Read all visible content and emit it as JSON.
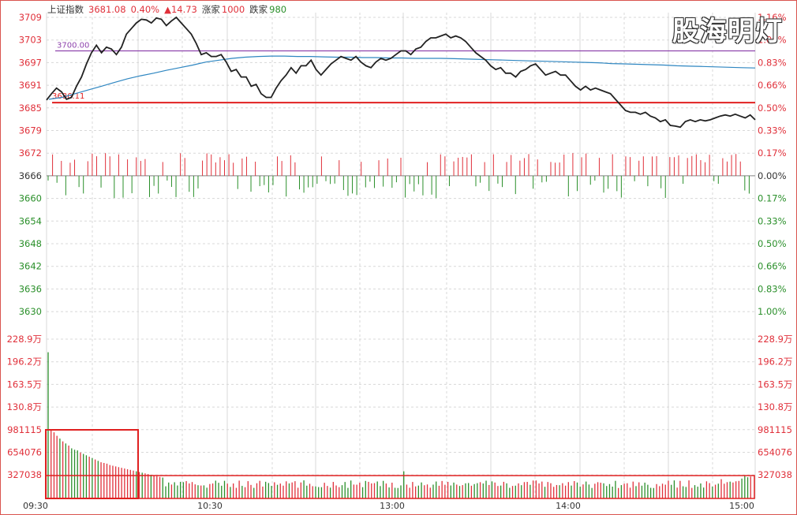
{
  "header": {
    "name": "上证指数",
    "price": "3681.08",
    "pct": "0.40%",
    "change": "▲14.73",
    "up_label": "涨家",
    "up_count": "1000",
    "down_label": "跌家",
    "down_count": "980"
  },
  "watermark": "股海明灯",
  "colors": {
    "up": "#e0303a",
    "down": "#2a8f2a",
    "price_line": "#222222",
    "avg_line": "#2e86c1",
    "ref_line": "#8e44ad",
    "base_line": "#e02020",
    "grid": "#d8d8d8",
    "box": "#e02020"
  },
  "chart_data": [
    {
      "type": "line",
      "title": "",
      "y_left_ticks": [
        "3709",
        "3703",
        "3697",
        "3691",
        "3685",
        "3679",
        "3672",
        "3666",
        "3660",
        "3654",
        "3648",
        "3642",
        "3636",
        "3630"
      ],
      "y_right_ticks": [
        "1.16%",
        "1.00%",
        "0.83%",
        "0.66%",
        "0.50%",
        "0.33%",
        "0.17%",
        "0.00%",
        "0.17%",
        "0.33%",
        "0.50%",
        "0.66%",
        "0.83%",
        "1.00%"
      ],
      "ylim": [
        3630,
        3709
      ],
      "prev_close": 3666,
      "x_ticks": [
        "09:30",
        "10:30",
        "13:00",
        "14:00",
        "15:00"
      ],
      "annotations": [
        {
          "label": "3700.00",
          "y": 3700
        },
        {
          "label": "3686.11",
          "y": 3686.11
        }
      ],
      "price_series": [
        3686.8,
        3688.5,
        3690.0,
        3689.0,
        3687.0,
        3687.5,
        3690.5,
        3693.0,
        3696.5,
        3699.5,
        3701.5,
        3699.5,
        3701.0,
        3700.5,
        3699.0,
        3701.0,
        3704.5,
        3706.0,
        3707.5,
        3708.5,
        3708.3,
        3707.5,
        3708.8,
        3708.5,
        3706.8,
        3708.0,
        3709.0,
        3707.5,
        3706.0,
        3704.5,
        3702.0,
        3699.0,
        3699.5,
        3698.5,
        3698.5,
        3699.0,
        3697.0,
        3694.5,
        3695.0,
        3693.0,
        3693.0,
        3690.5,
        3691.0,
        3688.5,
        3687.5,
        3687.5,
        3690.0,
        3692.0,
        3693.5,
        3695.5,
        3694.0,
        3696.0,
        3696.0,
        3697.5,
        3695.0,
        3693.5,
        3695.0,
        3696.5,
        3697.5,
        3698.5,
        3698.0,
        3697.5,
        3698.5,
        3697.0,
        3696.0,
        3695.5,
        3697.0,
        3698.0,
        3697.5,
        3698.0,
        3699.0,
        3700.0,
        3700.0,
        3699.0,
        3700.5,
        3701.0,
        3702.5,
        3703.5,
        3703.5,
        3704.0,
        3704.5,
        3703.5,
        3704.0,
        3703.5,
        3702.5,
        3701.0,
        3699.5,
        3698.5,
        3697.5,
        3696.0,
        3695.0,
        3695.5,
        3694.0,
        3694.0,
        3693.0,
        3694.5,
        3695.0,
        3696.0,
        3696.5,
        3695.0,
        3693.5,
        3694.0,
        3694.5,
        3693.5,
        3693.5,
        3692.0,
        3690.5,
        3689.5,
        3690.5,
        3689.5,
        3690.0,
        3689.5,
        3689.0,
        3688.5,
        3687.0,
        3685.5,
        3684.0,
        3683.5,
        3683.5,
        3683.0,
        3683.5,
        3682.5,
        3682.0,
        3681.0,
        3681.5,
        3680.0,
        3679.8,
        3679.5,
        3681.0,
        3681.5,
        3681.0,
        3681.5,
        3681.2,
        3681.5,
        3682.0,
        3682.5,
        3682.8,
        3682.5,
        3683.0,
        3682.5,
        3682.0,
        3682.8,
        3681.5
      ],
      "avg_series": [
        3687.0,
        3687.5,
        3688.5,
        3689.5,
        3690.5,
        3691.5,
        3692.5,
        3693.3,
        3694.0,
        3694.8,
        3695.5,
        3696.2,
        3697.0,
        3697.5,
        3698.0,
        3698.3,
        3698.5,
        3698.6,
        3698.6,
        3698.5,
        3698.5,
        3698.4,
        3698.3,
        3698.3,
        3698.2,
        3698.2,
        3698.1,
        3698.1,
        3698.0,
        3698.0,
        3698.0,
        3697.9,
        3697.8,
        3697.7,
        3697.6,
        3697.5,
        3697.4,
        3697.3,
        3697.2,
        3697.1,
        3697.0,
        3696.9,
        3696.8,
        3696.6,
        3696.5,
        3696.4,
        3696.3,
        3696.2,
        3696.0,
        3695.9,
        3695.8,
        3695.7,
        3695.6,
        3695.5,
        3695.4
      ]
    },
    {
      "type": "bar",
      "title": "",
      "y_left_ticks": [
        "228.9万",
        "196.2万",
        "163.5万",
        "130.8万",
        "981115",
        "654076",
        "327038"
      ],
      "y_right_ticks": [
        "228.9万",
        "196.2万",
        "163.5万",
        "130.8万",
        "981115",
        "654076",
        "327038"
      ],
      "ylim": [
        0,
        2289000
      ],
      "volume_values": [
        2100000,
        980000,
        950000,
        900000,
        860000,
        820000,
        790000,
        760000,
        720000,
        700000,
        690000,
        660000,
        640000,
        620000,
        600000,
        580000,
        560000,
        540000,
        520000,
        510000,
        500000,
        480000,
        470000,
        460000,
        450000,
        440000,
        430000,
        420000,
        410000,
        400000,
        390000,
        380000,
        370000,
        360000,
        350000,
        340000,
        330000,
        320000,
        310000,
        300000
      ]
    }
  ]
}
